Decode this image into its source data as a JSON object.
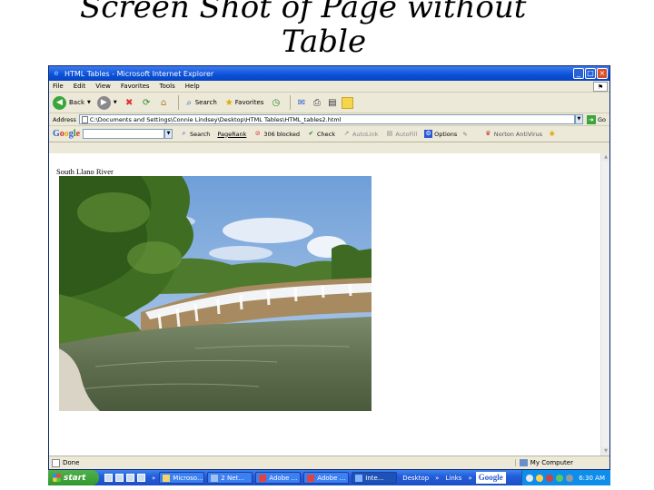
{
  "slide": {
    "title_line1": "Screen Shot of Page without",
    "title_line2": "Table"
  },
  "window": {
    "title": "HTML Tables - Microsoft Internet Explorer",
    "controls": {
      "minimize": "_",
      "maximize": "□",
      "close": "×"
    }
  },
  "menu": [
    "File",
    "Edit",
    "View",
    "Favorites",
    "Tools",
    "Help"
  ],
  "toolbar": {
    "back_label": "Back",
    "search_label": "Search",
    "favorites_label": "Favorites"
  },
  "address": {
    "label": "Address",
    "value": "C:\\Documents and Settings\\Connie Lindsey\\Desktop\\HTML Tables\\HTML_tables2.html",
    "go_label": "Go"
  },
  "google_bar": {
    "logo": "Google",
    "search_label": "Search",
    "pagerank_label": "PageRank",
    "blocked_label": "306 blocked",
    "check_label": "Check",
    "autolink_label": "AutoLink",
    "autofill_label": "AutoFill",
    "options_label": "Options",
    "norton_label": "Norton AntiVirus"
  },
  "page": {
    "heading": "South Llano River"
  },
  "status": {
    "text": "Done",
    "zone": "My Computer"
  },
  "taskbar": {
    "start_label": "start",
    "tasks": [
      "Microso...",
      "2 Net...",
      "Adobe ...",
      "Adobe ...",
      "Inte..."
    ],
    "desktop_label": "Desktop",
    "links_label": "Links",
    "clock": "6:30 AM"
  },
  "colors": {
    "titlebar": "#0a50d8",
    "taskbar": "#245edb",
    "start_button": "#33972f",
    "window_chrome": "#ece9d8"
  }
}
